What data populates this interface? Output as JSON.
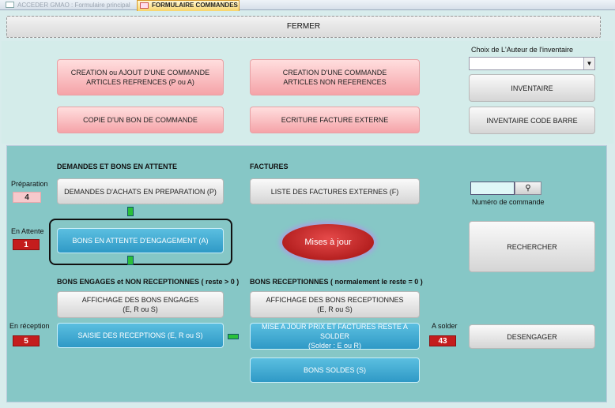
{
  "tabs": [
    {
      "label": "ACCEDER GMAO : Formulaire principal",
      "active": false
    },
    {
      "label": "FORMULAIRE COMMANDES",
      "active": true
    }
  ],
  "close_label": "FERMER",
  "top": {
    "btn_create_ref": "CREATION ou AJOUT D'UNE  COMMANDE\nARTICLES REFRENCES (P ou A)",
    "btn_create_nonref": "CREATION D'UNE COMMANDE\nARTICLES NON REFERENCES",
    "btn_copy": "COPIE D'UN BON DE COMMANDE",
    "btn_invoice": "ECRITURE FACTURE EXTERNE",
    "author_label": "Choix de L'Auteur de l'inventaire",
    "author_value": "",
    "btn_inventory": "INVENTAIRE",
    "btn_inventory_barcode": "INVENTAIRE CODE BARRE"
  },
  "bottom": {
    "section_pending": "DEMANDES ET BONS EN ATTENTE",
    "section_invoices": "FACTURES",
    "prep_label": "Préparation",
    "prep_count": "4",
    "btn_prep": "DEMANDES D'ACHATS EN PREPARATION (P)",
    "btn_invoice_list": "LISTE DES FACTURES EXTERNES (F)",
    "waiting_label": "En Attente",
    "waiting_count": "1",
    "btn_waiting": "BONS EN ATTENTE D'ENGAGEMENT (A)",
    "update_label": "Mises à jour",
    "section_engaged": "BONS ENGAGES et NON RECEPTIONNES ( reste > 0 )",
    "section_received": "BONS RECEPTIONNES ( normalement le reste = 0 )",
    "btn_show_engaged": "AFFICHAGE DES BONS ENGAGES\n(E, R ou S)",
    "btn_show_received": "AFFICHAGE DES BONS RECEPTIONNES\n(E, R ou S)",
    "reception_label": "En réception",
    "reception_count": "5",
    "btn_entry_reception": "SAISIE DES RECEPTIONS (E, R ou S)",
    "btn_update_prices": "MISE A JOUR PRIX ET FACTURES RESTE A SOLDER\n(Solder : E ou R)",
    "to_settle_label": "A solder",
    "to_settle_count": "43",
    "btn_settled": "BONS SOLDES (S)",
    "order_number_label": "Numéro de commande",
    "order_number_value": "",
    "btn_search": "RECHERCHER",
    "btn_disengage": "DESENGAGER"
  },
  "colors": {
    "pink_button": "#f5a3a8",
    "blue_button": "#2f99c6",
    "panel": "#86c7c6",
    "counter_red": "#c41d1d",
    "counter_pink": "#f6c9cc",
    "arrow_green": "#2ac03a"
  },
  "icons": {
    "search": "binoculars-icon",
    "dropdown": "chevron-down-icon"
  }
}
